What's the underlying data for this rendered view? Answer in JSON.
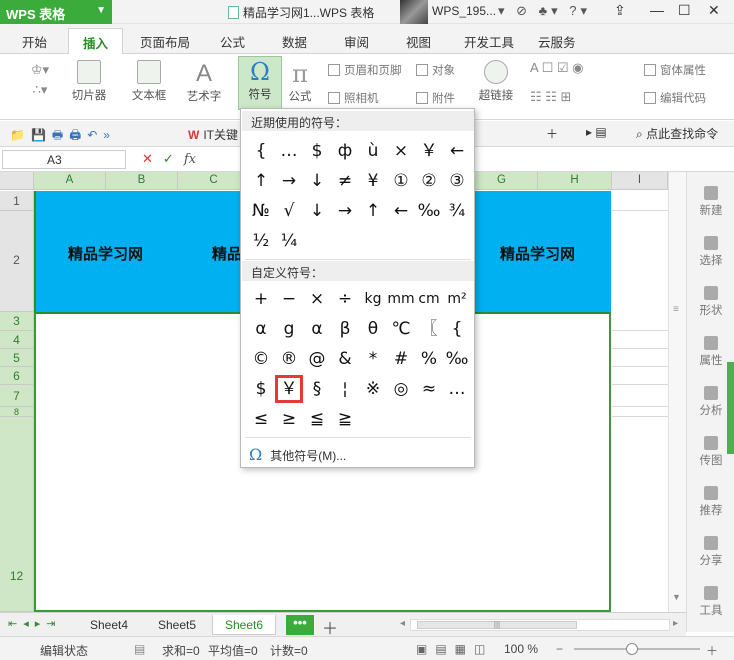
{
  "titlebar": {
    "app_label": "WPS 表格",
    "doc_title": "精品学习网1...WPS 表格",
    "user_name": "WPS_195..."
  },
  "menu": [
    "开始",
    "插入",
    "页面布局",
    "公式",
    "数据",
    "审阅",
    "视图",
    "开发工具",
    "云服务"
  ],
  "ribbon": {
    "slicer": "切片器",
    "textbox": "文本框",
    "wordart": "艺术字",
    "symbol": "符号",
    "formula": "公式",
    "header_footer": "页眉和页脚",
    "object": "对象",
    "camera": "照相机",
    "attachment": "附件",
    "hyperlink": "超链接",
    "form_props": "窗体属性",
    "edit_code": "编辑代码"
  },
  "qat": {
    "doc_tab": "IT关键",
    "find_cmd": "点此查找命令"
  },
  "formula_bar": {
    "name_box": "A3",
    "fx": "fx"
  },
  "columns": [
    "A",
    "B",
    "C",
    "D",
    "E",
    "F",
    "G",
    "H",
    "I"
  ],
  "rows": [
    "1",
    "2",
    "3",
    "4",
    "5",
    "6",
    "7",
    "8",
    "12"
  ],
  "cells": {
    "a2": "精品学习网",
    "c2": "精品",
    "g2": "精品学习网"
  },
  "right_panel": [
    "新建",
    "选择",
    "形状",
    "属性",
    "分析",
    "传图",
    "推荐",
    "分享",
    "工具"
  ],
  "sheet_tabs": [
    "Sheet4",
    "Sheet5",
    "Sheet6"
  ],
  "active_sheet": "Sheet6",
  "statusbar": {
    "mode": "编辑状态",
    "sum": "求和=0",
    "avg": "平均值=0",
    "count": "计数=0",
    "zoom": "100 %"
  },
  "symbol_dropdown": {
    "recent_header": "近期使用的符号：",
    "recent": [
      "{",
      "…",
      "$",
      "ф",
      "ù",
      "×",
      "￥",
      "←",
      "↑",
      "→",
      "↓",
      "≠",
      "¥",
      "①",
      "②",
      "③",
      "№",
      "√",
      "↓",
      "→",
      "↑",
      "←",
      "‰",
      "¾",
      "½",
      "¼"
    ],
    "custom_header": "自定义符号：",
    "custom": [
      "+",
      "−",
      "×",
      "÷",
      "kg",
      "mm",
      "cm",
      "m²",
      "α",
      "g",
      "α",
      "β",
      "θ",
      "℃",
      "〖",
      "{",
      "©",
      "®",
      "@",
      "&",
      "*",
      "#",
      "%",
      "‰",
      "$",
      "￥",
      "§",
      "¦",
      "※",
      "◎",
      "≈",
      "…",
      "≤",
      "≥",
      "≦",
      "≧"
    ],
    "highlighted_symbol": "￥",
    "more": "其他符号(M)..."
  }
}
